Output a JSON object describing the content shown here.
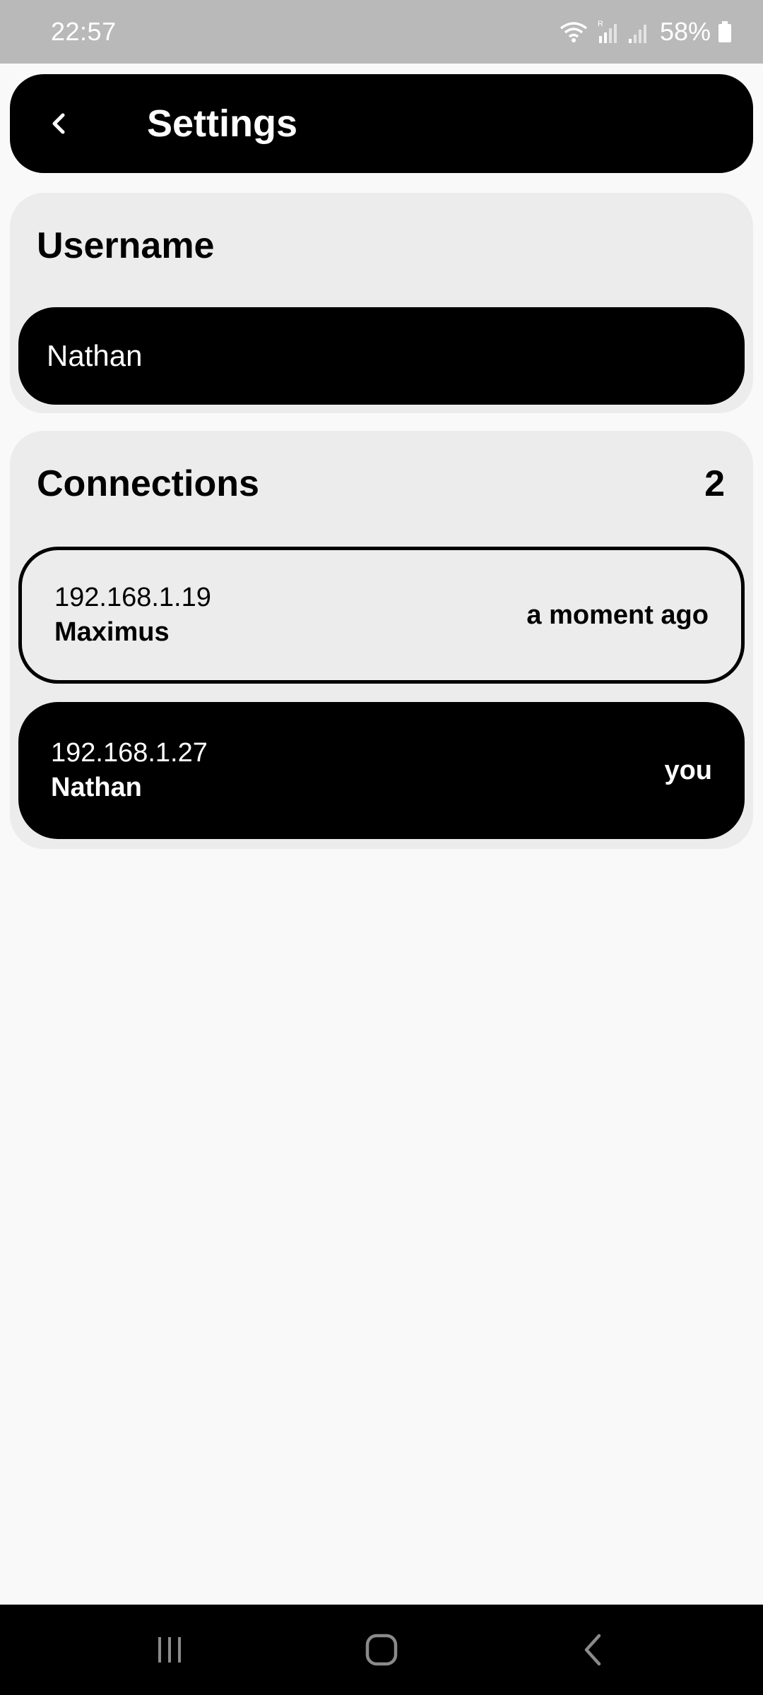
{
  "status_bar": {
    "time": "22:57",
    "battery": "58%",
    "icons": [
      "wifi-icon",
      "signal-roaming-icon",
      "signal-icon",
      "battery-icon"
    ]
  },
  "app_bar": {
    "title": "Settings",
    "back_icon": "chevron-left-icon"
  },
  "username": {
    "heading": "Username",
    "value": "Nathan"
  },
  "connections": {
    "heading": "Connections",
    "count": "2",
    "items": [
      {
        "ip": "192.168.1.19",
        "name": "Maximus",
        "status": "a moment ago"
      },
      {
        "ip": "192.168.1.27",
        "name": "Nathan",
        "status": "you"
      }
    ]
  },
  "nav_bar": {
    "icons": [
      "recent-apps-icon",
      "home-icon",
      "back-icon"
    ]
  },
  "colors": {
    "background": "#f9f9f9",
    "card": "#ececec",
    "accent": "#000000",
    "status_bar": "#b9b9b9"
  }
}
